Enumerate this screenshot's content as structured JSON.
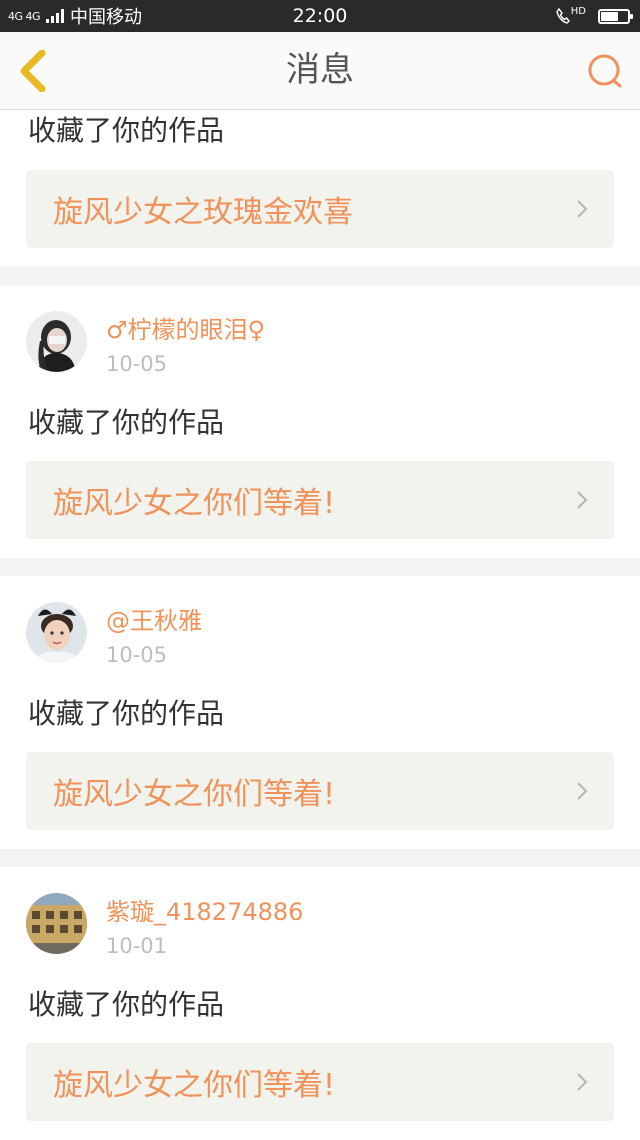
{
  "status_bar": {
    "network": "4G 4G",
    "carrier": "中国移动",
    "time": "22:00",
    "hd_label": "HD",
    "battery_level": 0.65
  },
  "header": {
    "title": "消息"
  },
  "messages": [
    {
      "action": "收藏了你的作品",
      "work_title": "旋风少女之玫瑰金欢喜"
    },
    {
      "username": "♂柠檬的眼泪♀",
      "date": "10-05",
      "action": "收藏了你的作品",
      "work_title": "旋风少女之你们等着!"
    },
    {
      "username": "@王秋雅",
      "date": "10-05",
      "action": "收藏了你的作品",
      "work_title": "旋风少女之你们等着!"
    },
    {
      "username": "紫璇_418274886",
      "date": "10-01",
      "action": "收藏了你的作品",
      "work_title": "旋风少女之你们等着!"
    }
  ],
  "colors": {
    "accent": "#f0925a",
    "back_icon": "#e8b923",
    "status_bar_bg": "#2a2a2a"
  }
}
